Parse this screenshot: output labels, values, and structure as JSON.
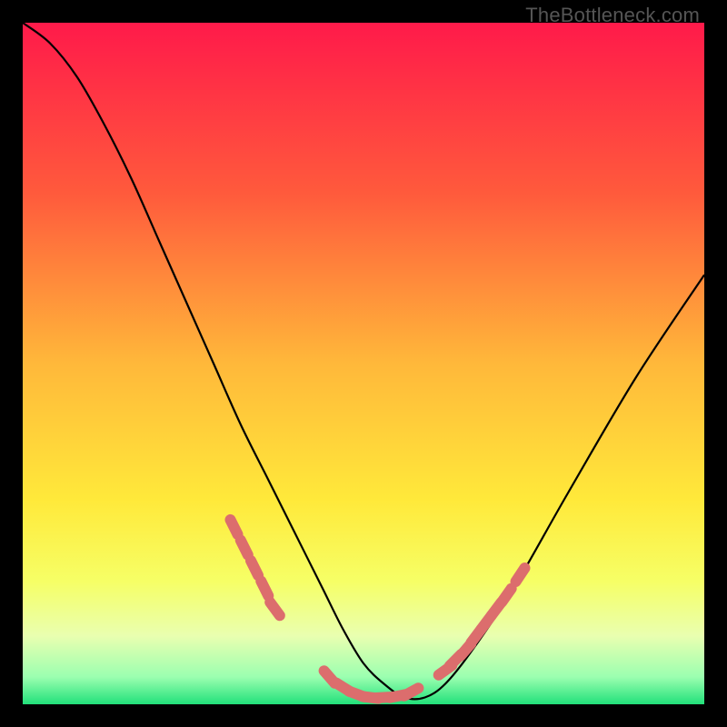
{
  "watermark": "TheBottleneck.com",
  "chart_data": {
    "type": "line",
    "title": "",
    "xlabel": "",
    "ylabel": "",
    "xlim": [
      0,
      100
    ],
    "ylim": [
      0,
      100
    ],
    "gradient_stops": [
      {
        "offset": 0,
        "color": "#ff1a4a"
      },
      {
        "offset": 25,
        "color": "#ff5a3c"
      },
      {
        "offset": 50,
        "color": "#ffb83a"
      },
      {
        "offset": 70,
        "color": "#ffe93a"
      },
      {
        "offset": 82,
        "color": "#f6ff66"
      },
      {
        "offset": 90,
        "color": "#e9ffb0"
      },
      {
        "offset": 96,
        "color": "#9bffb0"
      },
      {
        "offset": 100,
        "color": "#22e07a"
      }
    ],
    "series": [
      {
        "name": "curve",
        "style": "solid",
        "color": "#000000",
        "x": [
          0,
          4,
          8,
          12,
          16,
          20,
          24,
          28,
          32,
          36,
          40,
          44,
          47,
          50,
          53,
          56,
          59,
          62,
          66,
          72,
          80,
          90,
          100
        ],
        "y": [
          100,
          97,
          92,
          85,
          77,
          68,
          59,
          50,
          41,
          33,
          25,
          17,
          11,
          6,
          3,
          1,
          1,
          3,
          8,
          17,
          31,
          48,
          63
        ]
      },
      {
        "name": "markers",
        "style": "points",
        "color": "#dc6d6d",
        "x": [
          31,
          32.5,
          34,
          35.5,
          37,
          45,
          47,
          49,
          51,
          53,
          55,
          57,
          62,
          63.5,
          65,
          66.5,
          68,
          69.5,
          71,
          73
        ],
        "y": [
          26,
          23,
          20,
          17,
          14,
          4,
          2.5,
          1.5,
          1,
          1,
          1.2,
          1.8,
          5,
          6.5,
          8,
          10,
          12,
          14,
          16,
          19
        ]
      }
    ]
  }
}
